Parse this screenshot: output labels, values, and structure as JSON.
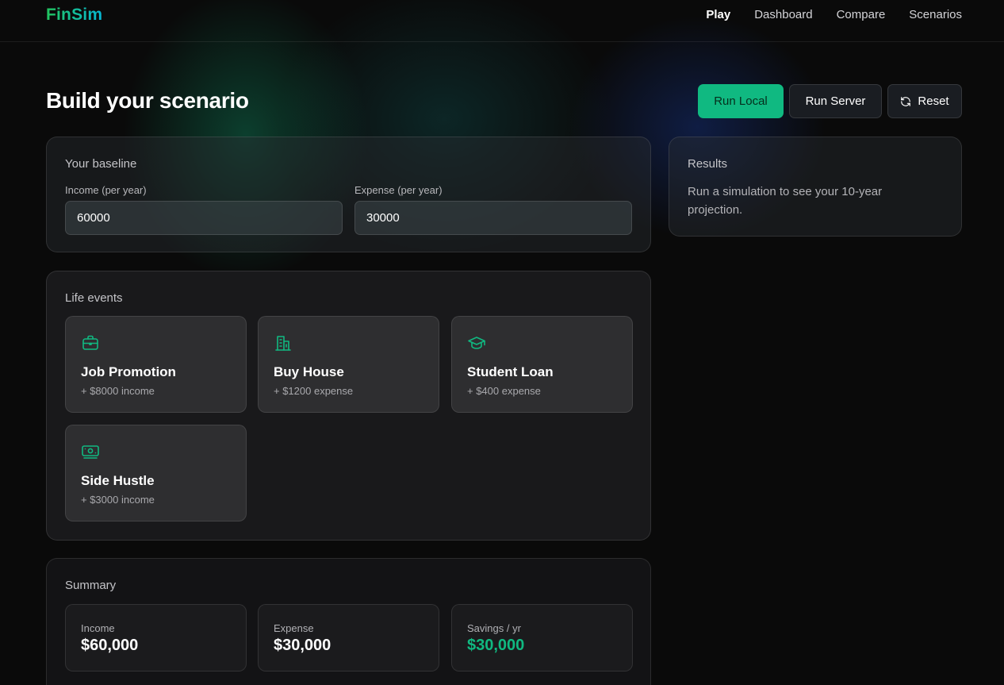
{
  "app": {
    "brand": "FinSim"
  },
  "nav": {
    "items": [
      {
        "label": "Play",
        "active": true
      },
      {
        "label": "Dashboard",
        "active": false
      },
      {
        "label": "Compare",
        "active": false
      },
      {
        "label": "Scenarios",
        "active": false
      }
    ]
  },
  "page": {
    "title": "Build your scenario"
  },
  "actions": {
    "run_local": "Run Local",
    "run_server": "Run Server",
    "reset": "Reset"
  },
  "baseline": {
    "title": "Your baseline",
    "income_label": "Income (per year)",
    "income_value": "60000",
    "expense_label": "Expense (per year)",
    "expense_value": "30000"
  },
  "results": {
    "title": "Results",
    "message": "Run a simulation to see your 10-year projection."
  },
  "life_events": {
    "title": "Life events",
    "items": [
      {
        "title": "Job Promotion",
        "subtitle": "+ $8000 income",
        "icon": "briefcase-icon"
      },
      {
        "title": "Buy House",
        "subtitle": "+ $1200 expense",
        "icon": "house-icon"
      },
      {
        "title": "Student Loan",
        "subtitle": "+ $400 expense",
        "icon": "graduation-cap-icon"
      },
      {
        "title": "Side Hustle",
        "subtitle": "+ $3000 income",
        "icon": "banknote-icon"
      }
    ]
  },
  "summary": {
    "title": "Summary",
    "cards": [
      {
        "label": "Income",
        "value": "$60,000"
      },
      {
        "label": "Expense",
        "value": "$30,000"
      },
      {
        "label": "Savings / yr",
        "value": "$30,000"
      }
    ]
  },
  "colors": {
    "accent": "#10b981",
    "background": "#0a0a0a",
    "brand_gradient_start": "#22c55e",
    "brand_gradient_end": "#06b6d4"
  }
}
